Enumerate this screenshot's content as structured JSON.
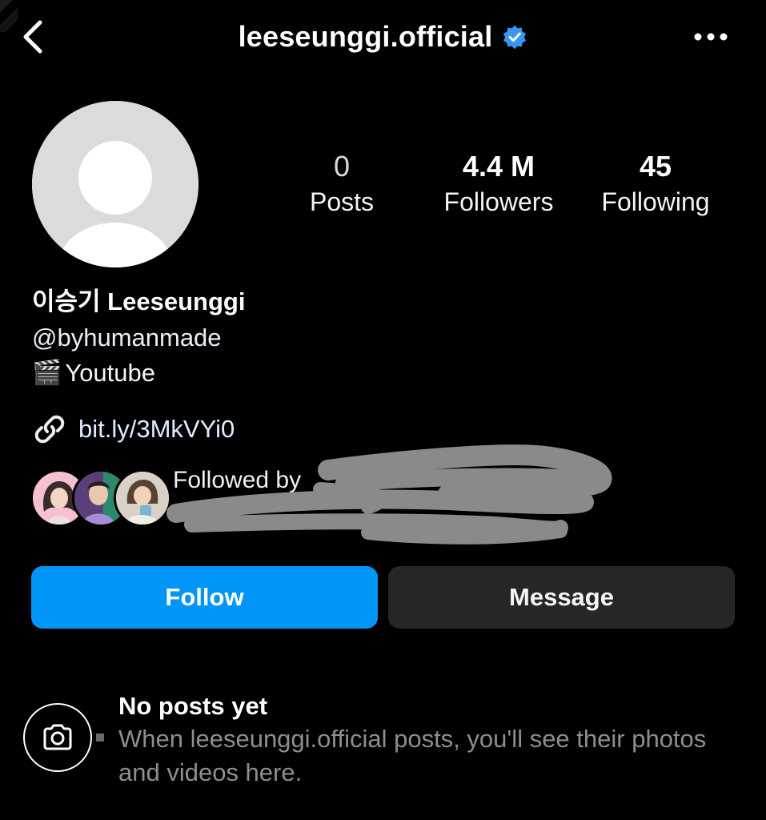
{
  "header": {
    "username": "leeseunggi.official",
    "back_icon": "chevron-left-icon",
    "verified_icon": "verified-badge-icon",
    "more_icon": "more-horizontal-icon"
  },
  "stats": {
    "posts": {
      "value": "0",
      "label": "Posts"
    },
    "followers": {
      "value": "4.4 M",
      "label": "Followers"
    },
    "following": {
      "value": "45",
      "label": "Following"
    }
  },
  "bio": {
    "name": "이승기 Leeseunggi",
    "tag": "@byhumanmade",
    "emoji": "🎬",
    "line": "Youtube",
    "link_icon": "link-icon",
    "link": "bit.ly/3MkVYi0"
  },
  "followed_by": {
    "text": "Followed by"
  },
  "actions": {
    "follow": "Follow",
    "message": "Message"
  },
  "empty_state": {
    "icon": "camera-icon",
    "title": "No posts yet",
    "description": "When leeseunggi.official posts, you'll see their photos and videos here."
  },
  "colors": {
    "accent": "#0095f6",
    "verified": "#3897f0",
    "secondary_button": "#262626",
    "muted_text": "#8e8e8e"
  }
}
